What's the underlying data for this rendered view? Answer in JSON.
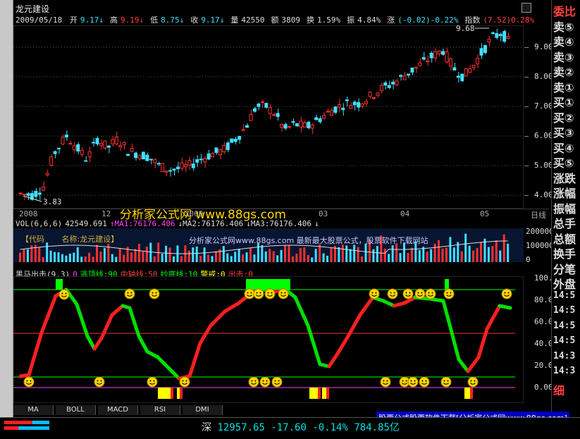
{
  "stock": {
    "name": "龙元建设",
    "date": "2009/05/18",
    "quote": [
      {
        "label": "开",
        "value": "9.17",
        "arrow": "↓",
        "color": "#40e0ff"
      },
      {
        "label": "高",
        "value": "9.19",
        "arrow": "↓",
        "color": "#ff4040"
      },
      {
        "label": "低",
        "value": "8.75",
        "arrow": "↓",
        "color": "#40e0ff"
      },
      {
        "label": "收",
        "value": "9.17",
        "arrow": "↓",
        "color": "#40e0ff"
      },
      {
        "label": "量",
        "value": "42550",
        "arrow": "",
        "color": "#dddddd"
      },
      {
        "label": "额",
        "value": "3809",
        "arrow": "",
        "color": "#dddddd"
      },
      {
        "label": "换",
        "value": "1.59%",
        "arrow": "",
        "color": "#dddddd"
      },
      {
        "label": "振",
        "value": "4.84%",
        "arrow": "",
        "color": "#dddddd"
      },
      {
        "label": "涨",
        "value": "(-0.02)-0.22%",
        "arrow": "",
        "color": "#40e0ff"
      },
      {
        "label": "指数",
        "value": "(7.52)0.28%",
        "arrow": "",
        "color": "#ff4040"
      }
    ],
    "top_right": "6"
  },
  "price_chart": {
    "y_ticks": [
      "9.00",
      "8.00",
      "7.00",
      "6.00",
      "5.00",
      "4.00"
    ],
    "high_label": "9.68",
    "low_label": "3.83",
    "dates": [
      "2008",
      "12",
      "2009",
      "03",
      "04",
      "05",
      "日线"
    ]
  },
  "volume": {
    "header": [
      {
        "text": "VOL(6,6,6)",
        "color": "#dddddd"
      },
      {
        "text": "42549.691",
        "color": "#dddddd"
      },
      {
        "text": "↑MA1:76176.406",
        "color": "#ff40ff"
      },
      {
        "text": "↓MA2:76176.406",
        "color": "#dddddd"
      },
      {
        "text": "↓MA3:76176.406",
        "color": "#dddddd"
      },
      {
        "text": "↓",
        "color": "#dddddd"
      }
    ],
    "y_ticks": [
      "200000",
      "100000",
      "0"
    ],
    "stock_tag": "【代码",
    "stock_tag2": "名称:龙元建设】",
    "banner": "分析家公式网www.88gs.com 最新最大股票公式，股票软件下载网站"
  },
  "indicator": {
    "header": [
      {
        "text": "黑马出击(9,3)",
        "color": "#dddddd"
      },
      {
        "text": "0",
        "color": "#ff40ff"
      },
      {
        "text": "逃顶线:90",
        "color": "#00ff00"
      },
      {
        "text": "中轴线:50",
        "color": "#ff4040"
      },
      {
        "text": "抄底线:10",
        "color": "#00ff00"
      },
      {
        "text": "警戒:0",
        "color": "#ffff00"
      },
      {
        "text": "出击:0",
        "color": "#ff4040"
      }
    ],
    "y_ticks": [
      "100.00",
      "80.00",
      "60.00",
      "40.00",
      "20.00",
      "0.00"
    ]
  },
  "watermark": "分析家公式网 www.88gs.com",
  "tabs": [
    "MA",
    "BOLL",
    "MACD",
    "RSI",
    "DMI"
  ],
  "right_column": [
    {
      "text": "委比",
      "color": "#ff4040"
    },
    {
      "text": "卖⑤",
      "color": "#dddddd"
    },
    {
      "text": "卖④",
      "color": "#dddddd"
    },
    {
      "text": "卖③",
      "color": "#dddddd"
    },
    {
      "text": "卖②",
      "color": "#dddddd"
    },
    {
      "text": "卖①",
      "color": "#dddddd"
    },
    {
      "text": "买①",
      "color": "#dddddd"
    },
    {
      "text": "买②",
      "color": "#dddddd"
    },
    {
      "text": "买③",
      "color": "#dddddd"
    },
    {
      "text": "买④",
      "color": "#dddddd"
    },
    {
      "text": "买⑤",
      "color": "#dddddd"
    },
    {
      "text": "涨跌",
      "color": "#dddddd"
    },
    {
      "text": "涨幅",
      "color": "#dddddd"
    },
    {
      "text": "振幅",
      "color": "#dddddd"
    },
    {
      "text": "总手",
      "color": "#dddddd"
    },
    {
      "text": "总额",
      "color": "#dddddd"
    },
    {
      "text": "换手",
      "color": "#dddddd"
    },
    {
      "text": "分笔",
      "color": "#dddddd"
    },
    {
      "text": "外盘",
      "color": "#dddddd"
    },
    {
      "text": "14:5",
      "color": "#dddddd"
    },
    {
      "text": "14:5",
      "color": "#dddddd"
    },
    {
      "text": "14:5",
      "color": "#dddddd"
    },
    {
      "text": "14:5",
      "color": "#dddddd"
    },
    {
      "text": "14:3",
      "color": "#dddddd"
    },
    {
      "text": "14:3",
      "color": "#dddddd"
    },
    {
      "text": "细",
      "color": "#ff4040"
    }
  ],
  "status": {
    "market": "深",
    "index": "12957.65",
    "change": "-17.60",
    "percent": "-0.14%",
    "amount": "784.85亿"
  },
  "ad": "股票公式股票软件下载[分析家公式网www.88gs.com]"
}
